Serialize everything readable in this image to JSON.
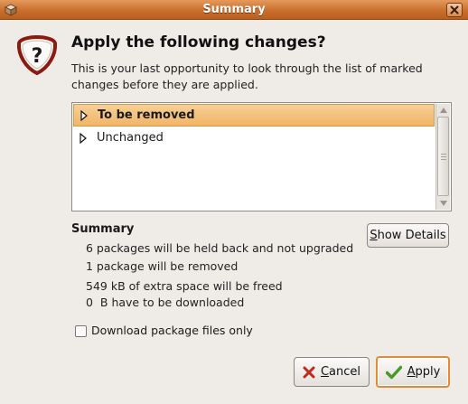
{
  "window": {
    "title": "Summary",
    "app_icon": "package-icon",
    "close_icon": "close-icon"
  },
  "dialog": {
    "icon": "question-icon",
    "heading": "Apply the following changes?",
    "description": "This is your last opportunity to look through the list of marked changes before they are applied."
  },
  "tree": {
    "rows": [
      {
        "label": "To be removed",
        "selected": true,
        "expander": "triangle-right-icon"
      },
      {
        "label": "Unchanged",
        "selected": false,
        "expander": "triangle-right-icon"
      }
    ]
  },
  "summary": {
    "title": "Summary",
    "lines": [
      "6 packages will be held back and not upgraded",
      "1 package will be removed",
      "549 kB of extra space will be freed",
      "0  B have to be downloaded"
    ],
    "show_details_prefix": "S",
    "show_details_rest": "how Details"
  },
  "options": {
    "download_only_label": "Download package files only",
    "download_only_checked": false
  },
  "buttons": {
    "cancel_prefix": "C",
    "cancel_rest": "ancel",
    "cancel_icon": "cancel-x-icon",
    "apply_prefix": "A",
    "apply_rest": "pply",
    "apply_icon": "checkmark-icon"
  },
  "colors": {
    "titlebar": "#c96f2d",
    "selection": "#f1b566",
    "default_button_border": "#e08b3b",
    "cancel_x": "#c0281c",
    "apply_check": "#4a9a2a"
  }
}
